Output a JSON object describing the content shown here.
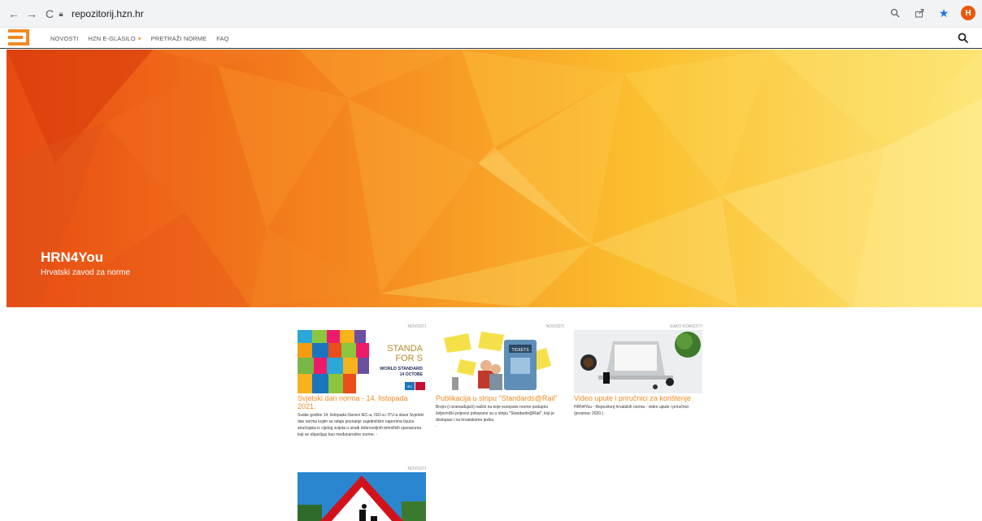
{
  "browser": {
    "url": "repozitorij.hzn.hr",
    "avatar_letter": "H",
    "icons": [
      "back-arrow-icon",
      "forward-arrow-icon",
      "reload-icon",
      "lock-icon",
      "zoom-icon",
      "share-icon",
      "bookmark-star-icon"
    ]
  },
  "nav": {
    "items": [
      {
        "label": "NOVOSTI"
      },
      {
        "label": "HZN E-GLASILO"
      },
      {
        "label": "PRETRAŽI NORME"
      },
      {
        "label": "FAQ"
      }
    ],
    "accent": "#f08a24"
  },
  "hero": {
    "title": "HRN4You",
    "subtitle": "Hrvatski zavod za norme"
  },
  "cards": [
    {
      "category": "NOVOSTI",
      "title": "Svjetski dan norma - 14. listopada 2021.",
      "text": "Svake godine 14. listopada članovi IEC-a, ISO-a i ITU-a slave Svjetski dan norma kojim se odaje priznanje zajedničkim naporima tisuća stručnjaka iz cijelog svijeta u izradi dobrovoljnih tehničkih sporazuma koji se objavljuju kao međunarodne norme.",
      "more": "›",
      "thumb_text": [
        "STANDA",
        "FOR S",
        "WORLD STANDARD",
        "14 OCTOBE",
        "IEC"
      ]
    },
    {
      "category": "NOVOSTI",
      "title": "Publikacija u stripu \"Standards@Rail\"",
      "text": "Brojni (i iznenađujući) načini na koje europske norme podupiru željeznički prijevoz prikazane su u stripu \"Standards@Rail\", koji je dostupan i na hrvatskome jeziku",
      "more": "›",
      "thumb_text": [
        "TICKETS"
      ]
    },
    {
      "category": "KAKO KORISTITI",
      "title": "Video upute i priručnici za korištenje",
      "text": "HRN4You - Repozitorij hrvatskih norma - video upute i priručnici (prosinac 2020.)",
      "more": "›",
      "thumb_text": []
    },
    {
      "category": "NOVOSTI",
      "title": "",
      "text": "",
      "more": "",
      "thumb_text": []
    }
  ]
}
